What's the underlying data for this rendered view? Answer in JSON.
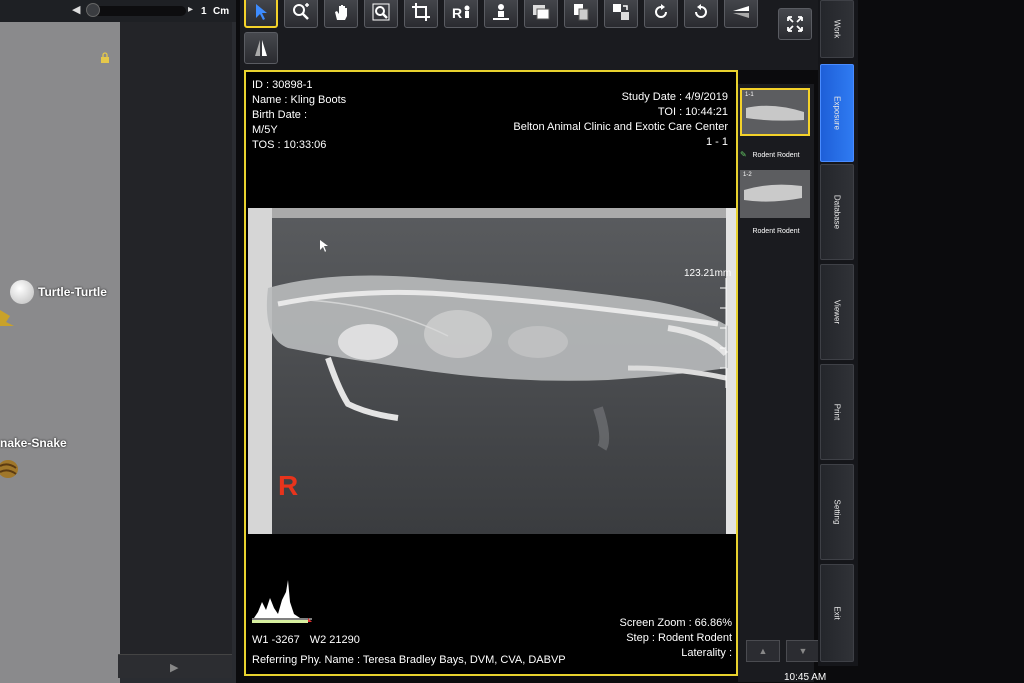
{
  "slider": {
    "value": "1",
    "unit": "Cm"
  },
  "species": [
    {
      "name": "Turtle-Turtle"
    },
    {
      "name": "nake-Snake"
    }
  ],
  "toolbar": {
    "tools": [
      "select",
      "zoom-in",
      "pan",
      "magnifier",
      "crop",
      "annotate",
      "label",
      "layout",
      "copy",
      "swap",
      "rotate-cw",
      "rotate-ccw",
      "flip-vertical",
      "flip-horizontal",
      "fullscreen"
    ]
  },
  "patient": {
    "id": "ID : 30898-1",
    "name": "Name : Kling Boots",
    "birth": "Birth Date :",
    "sex_age": "M/5Y",
    "tos": "TOS : 10:33:06"
  },
  "study": {
    "date": "Study Date : 4/9/2019",
    "toi": "TOI : 10:44:21",
    "clinic": "Belton Animal Clinic and Exotic Care Center",
    "series": "1 - 1"
  },
  "image": {
    "marker": "R",
    "measurement": "123.21mm"
  },
  "window": {
    "w1": "W1 -3267",
    "w2": "W2 21290"
  },
  "referring": "Referring Phy. Name : Teresa Bradley Bays, DVM, CVA, DABVP",
  "view_info": {
    "zoom": "Screen Zoom : 66.86%",
    "step": "Step : Rodent Rodent",
    "laterality": "Laterality :"
  },
  "thumbnails": [
    {
      "id": "1-1",
      "label": "Rodent Rodent"
    },
    {
      "id": "1-2",
      "label": "Rodent Rodent"
    }
  ],
  "sidetabs": [
    "Work",
    "Exposure",
    "Database",
    "Viewer",
    "Print",
    "Setting",
    "Exit"
  ],
  "clock": "10:45 AM",
  "colors": {
    "accent": "#f4d22a",
    "active_tab": "#2f7bf2",
    "marker": "#e8341c"
  }
}
